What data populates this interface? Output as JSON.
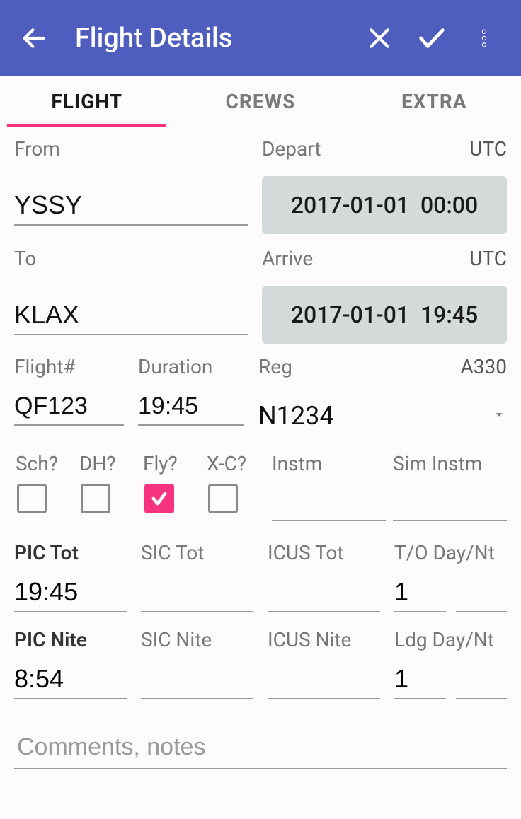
{
  "header": {
    "title": "Flight Details"
  },
  "tabs": {
    "flight": "FLIGHT",
    "crews": "CREWS",
    "extra": "EXTRA"
  },
  "labels": {
    "from": "From",
    "to": "To",
    "depart": "Depart",
    "arrive": "Arrive",
    "utc": "UTC",
    "flightno": "Flight#",
    "duration": "Duration",
    "reg": "Reg",
    "aircraft_type": "A330",
    "sch": "Sch?",
    "dh": "DH?",
    "fly": "Fly?",
    "xc": "X-C?",
    "instm": "Instm",
    "sim_instm": "Sim Instm",
    "pic_tot": "PIC Tot",
    "sic_tot": "SIC Tot",
    "icus_tot": "ICUS Tot",
    "to_daynt": "T/O Day/Nt",
    "pic_nite": "PIC Nite",
    "sic_nite": "SIC Nite",
    "icus_nite": "ICUS Nite",
    "ldg_daynt": "Ldg Day/Nt",
    "comments_placeholder": "Comments, notes"
  },
  "values": {
    "from": "YSSY",
    "to": "KLAX",
    "depart": "2017-01-01  00:00",
    "arrive": "2017-01-01  19:45",
    "flightno": "QF123",
    "duration": "19:45",
    "reg": "N1234",
    "sch": false,
    "dh": false,
    "fly": true,
    "xc": false,
    "instm": "",
    "sim_instm": "",
    "pic_tot": "19:45",
    "sic_tot": "",
    "icus_tot": "",
    "to_day": "1",
    "to_nt": "",
    "pic_nite": "8:54",
    "sic_nite": "",
    "icus_nite": "",
    "ldg_day": "1",
    "ldg_nt": "",
    "comments": ""
  }
}
